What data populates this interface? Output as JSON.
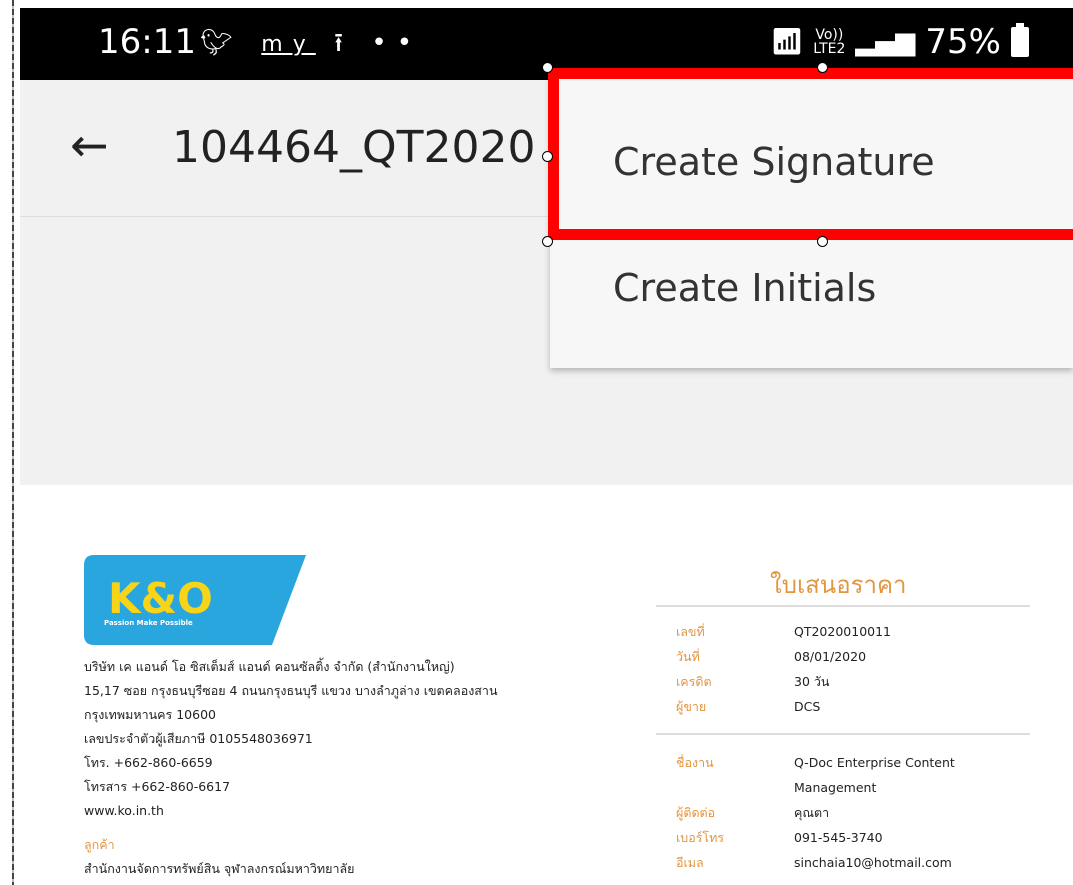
{
  "status_bar": {
    "time": "16:11",
    "notification_icons": [
      "twitter-icon",
      "my-ais-icon",
      "upload-icon",
      "more-dots-icon"
    ],
    "my_label": "my",
    "network_label_top": "Vo))",
    "network_label_bottom": "LTE2",
    "battery": "75%"
  },
  "app_bar": {
    "title": "104464_QT2020"
  },
  "menu": {
    "items": [
      {
        "label": "Create Signature"
      },
      {
        "label": "Create Initials"
      }
    ],
    "highlight_color": "#ff0000"
  },
  "document": {
    "logo_text": "K&O",
    "logo_tagline": "Passion Make Possible",
    "company_lines": [
      "บริษัท เค แอนด์ โอ ซิสเต็มส์ แอนด์ คอนซัลติ้ง จำกัด (สำนักงานใหญ่)",
      "15,17 ซอย กรุงธนบุรีซอย 4 ถนนกรุงธนบุรี แขวง บางลำภูล่าง เขตคลองสาน",
      "กรุงเทพมหานคร 10600",
      "เลขประจำตัวผู้เสียภาษี 0105548036971",
      "โทร. +662-860-6659",
      "โทรสาร +662-860-6617",
      "www.ko.in.th"
    ],
    "customer_label": "ลูกค้า",
    "customer_line": "สำนักงานจัดการทรัพย์สิน จุฬาลงกรณ์มหาวิทยาลัย",
    "quote_title": "ใบเสนอราคา",
    "quote_rows_1": [
      {
        "k": "เลขที่",
        "v": "QT2020010011"
      },
      {
        "k": "วันที่",
        "v": "08/01/2020"
      },
      {
        "k": "เครดิต",
        "v": "30 วัน"
      },
      {
        "k": "ผู้ขาย",
        "v": "DCS"
      }
    ],
    "quote_rows_2": [
      {
        "k": "ชื่องาน",
        "v": "Q-Doc Enterprise Content"
      },
      {
        "k": "",
        "v": "Management"
      },
      {
        "k": "ผู้ติดต่อ",
        "v": "คุณตา"
      },
      {
        "k": "เบอร์โทร",
        "v": "091-545-3740"
      },
      {
        "k": "อีเมล",
        "v": "sinchaia10@hotmail.com"
      }
    ]
  },
  "colors": {
    "accent_orange": "#e29640",
    "logo_blue": "#2aa6df",
    "logo_yellow": "#f7d417"
  }
}
